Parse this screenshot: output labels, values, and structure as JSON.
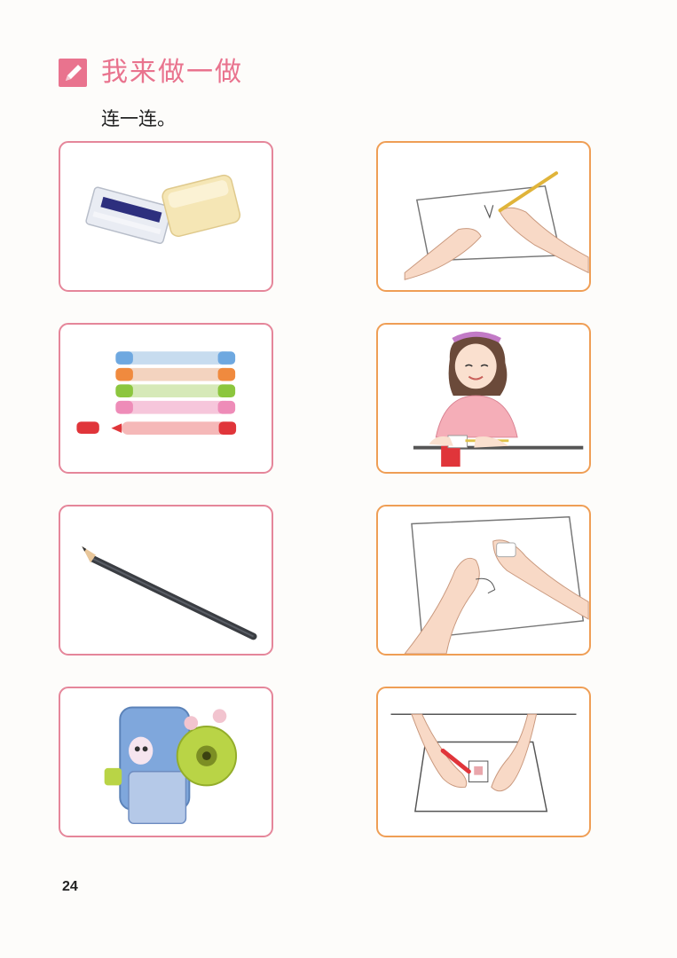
{
  "header": {
    "title": "我来做一做",
    "icon": "pencil-on-paper-icon"
  },
  "instruction": "连一连。",
  "left_items": [
    {
      "name": "eraser-and-sharpener-illustration"
    },
    {
      "name": "markers-illustration"
    },
    {
      "name": "pencil-illustration"
    },
    {
      "name": "desk-pencil-sharpener-illustration"
    }
  ],
  "right_items": [
    {
      "name": "drawing-on-paper-illustration"
    },
    {
      "name": "girl-sharpening-pencil-illustration"
    },
    {
      "name": "erasing-paper-illustration"
    },
    {
      "name": "coloring-with-marker-illustration"
    }
  ],
  "colors": {
    "accent": "#e9738e",
    "left_border": "#e5869a",
    "right_border": "#ef9e55"
  },
  "page_number": "24"
}
